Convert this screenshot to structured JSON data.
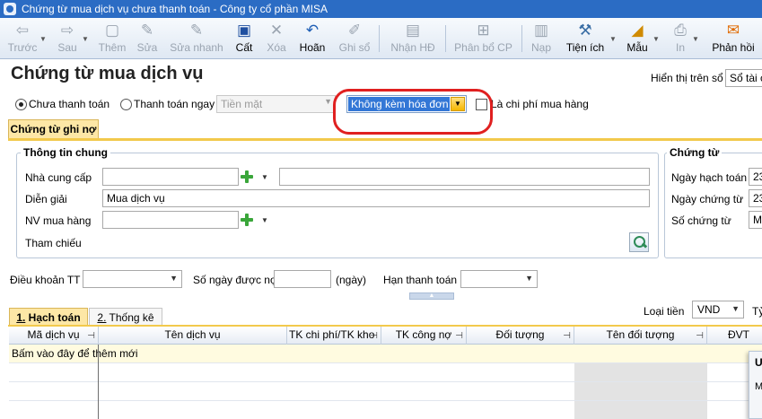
{
  "window": {
    "title": "Chứng từ mua dịch vụ chưa thanh toán - Công ty cổ phần MISA"
  },
  "toolbar": {
    "items": [
      {
        "label": "Trước",
        "icon": "arrow-left-icon"
      },
      {
        "label": "Sau",
        "icon": "arrow-right-icon"
      },
      {
        "label": "Thêm",
        "icon": "add-document-icon"
      },
      {
        "label": "Sửa",
        "icon": "edit-document-icon"
      },
      {
        "label": "Sửa nhanh",
        "icon": "quick-edit-icon"
      },
      {
        "label": "Cất",
        "icon": "save-icon"
      },
      {
        "label": "Xóa",
        "icon": "delete-icon"
      },
      {
        "label": "Hoãn",
        "icon": "undo-icon"
      },
      {
        "label": "Ghi sổ",
        "icon": "pencil-icon"
      },
      {
        "label": "Nhận HĐ",
        "icon": "receive-invoice-icon"
      },
      {
        "label": "Phân bổ CP",
        "icon": "allocate-cost-icon"
      },
      {
        "label": "Nạp",
        "icon": "load-icon"
      },
      {
        "label": "Tiện ích",
        "icon": "utilities-icon"
      },
      {
        "label": "Mẫu",
        "icon": "template-icon"
      },
      {
        "label": "In",
        "icon": "print-icon"
      },
      {
        "label": "Phản hồi",
        "icon": "feedback-icon"
      }
    ]
  },
  "header": {
    "title": "Chứng từ mua dịch vụ",
    "display_label": "Hiển thị trên sổ",
    "display_value": "Sổ tài c"
  },
  "payment": {
    "unpaid": "Chưa thanh toán",
    "pay_now": "Thanh toán ngay",
    "cash": "Tiền mặt",
    "invoice_option": "Không kèm hóa đơn",
    "is_purchase_cost": "Là chi phí mua hàng"
  },
  "tabs_top": {
    "voucher": "Chứng từ ghi nợ"
  },
  "general": {
    "title": "Thông tin chung",
    "supplier_label": "Nhà cung cấp",
    "supplier_value": "",
    "supplier_name": "",
    "description_label": "Diễn giải",
    "description_value": "Mua dịch vụ",
    "staff_label": "NV mua hàng",
    "staff_value": "",
    "reference_label": "Tham chiếu"
  },
  "voucher": {
    "title": "Chứng từ",
    "posting_date_label": "Ngày hạch toán",
    "posting_date": "23",
    "voucher_date_label": "Ngày chứng từ",
    "voucher_date": "23",
    "number_label": "Số chứng từ",
    "number": "M"
  },
  "terms": {
    "terms_label": "Điều khoản TT",
    "days_label": "Số ngày được nợ",
    "days_unit": "(ngày)",
    "due_label": "Hạn thanh toán"
  },
  "tabs_bottom": {
    "accounting_num": "1.",
    "accounting": " Hạch toán",
    "stats_num": "2.",
    "stats": " Thống kê"
  },
  "currency": {
    "label": "Loại tiền",
    "value": "VND",
    "rate_label": "Tỷ"
  },
  "grid": {
    "columns": [
      "Mã dịch vụ",
      "Tên dịch vụ",
      "TK chi phí/TK kho",
      "TK công nợ",
      "Đối tượng",
      "Tên đối tượng",
      "ĐVT"
    ],
    "new_row_hint": "Bấm vào đây để thêm mới"
  },
  "popup": {
    "header": "U",
    "line": "M"
  }
}
